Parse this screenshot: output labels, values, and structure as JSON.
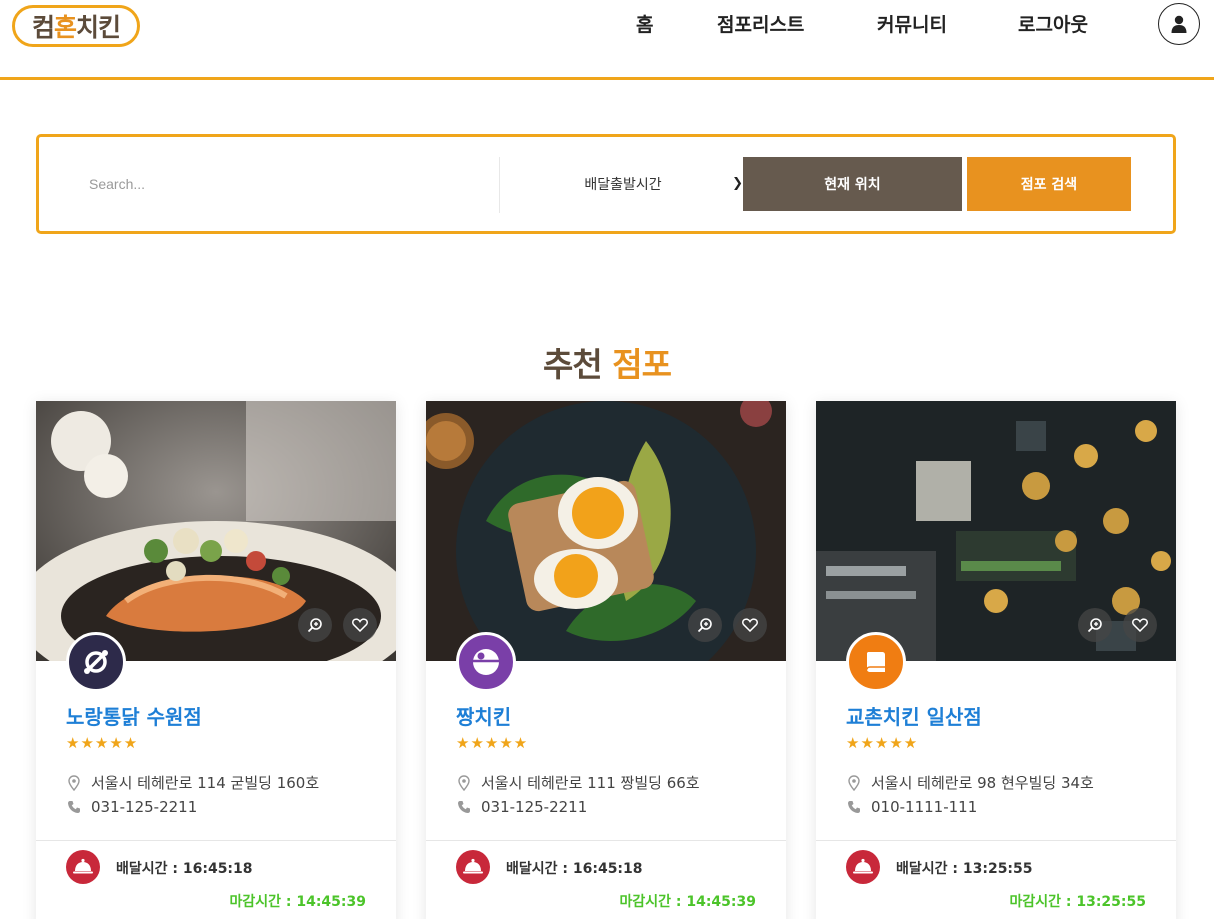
{
  "header": {
    "logo": {
      "part1": "컴",
      "part2": "혼",
      "part3": "치킨"
    },
    "nav": [
      "홈",
      "점포리스트",
      "커뮤니티",
      "로그아웃"
    ],
    "user_icon": "user-icon"
  },
  "search": {
    "placeholder": "Search...",
    "select_value": "배달출발시간",
    "location_button": "현재 위치",
    "search_button": "점포 검색"
  },
  "section": {
    "title_part1": "추천",
    "title_part2": "점포"
  },
  "cards": [
    {
      "name": "노랑통닭 수원점",
      "rating": "★★★★★",
      "address": "서울시 테헤란로 114 굳빌딩 160호",
      "phone": "031-125-2211",
      "delivery": "배달시간 : 16:45:18",
      "close": "마감시간 : 14:45:39",
      "logo_icon": "ring-logo-icon",
      "logo_color": "#2d2a4a"
    },
    {
      "name": "짱치킨",
      "rating": "★★★★★",
      "address": "서울시 테헤란로 111 짱빌딩 66호",
      "phone": "031-125-2211",
      "delivery": "배달시간 : 16:45:18",
      "close": "마감시간 : 14:45:39",
      "logo_icon": "sphere-logo-icon",
      "logo_color": "#7a3fa8"
    },
    {
      "name": "교촌치킨 일산점",
      "rating": "★★★★★",
      "address": "서울시 테헤란로 98 현우빌딩 34호",
      "phone": "010-1111-111",
      "delivery": "배달시간 : 13:25:55",
      "close": "마감시간 : 13:25:55",
      "logo_icon": "book-logo-icon",
      "logo_color": "#f07d12"
    }
  ],
  "colors": {
    "accent": "#f0a51a",
    "brand_brown": "#665a4e",
    "orange": "#e8921f",
    "link_blue": "#1e7fd6",
    "close_green": "#4cc42a",
    "delivery_red": "#c8283a"
  }
}
